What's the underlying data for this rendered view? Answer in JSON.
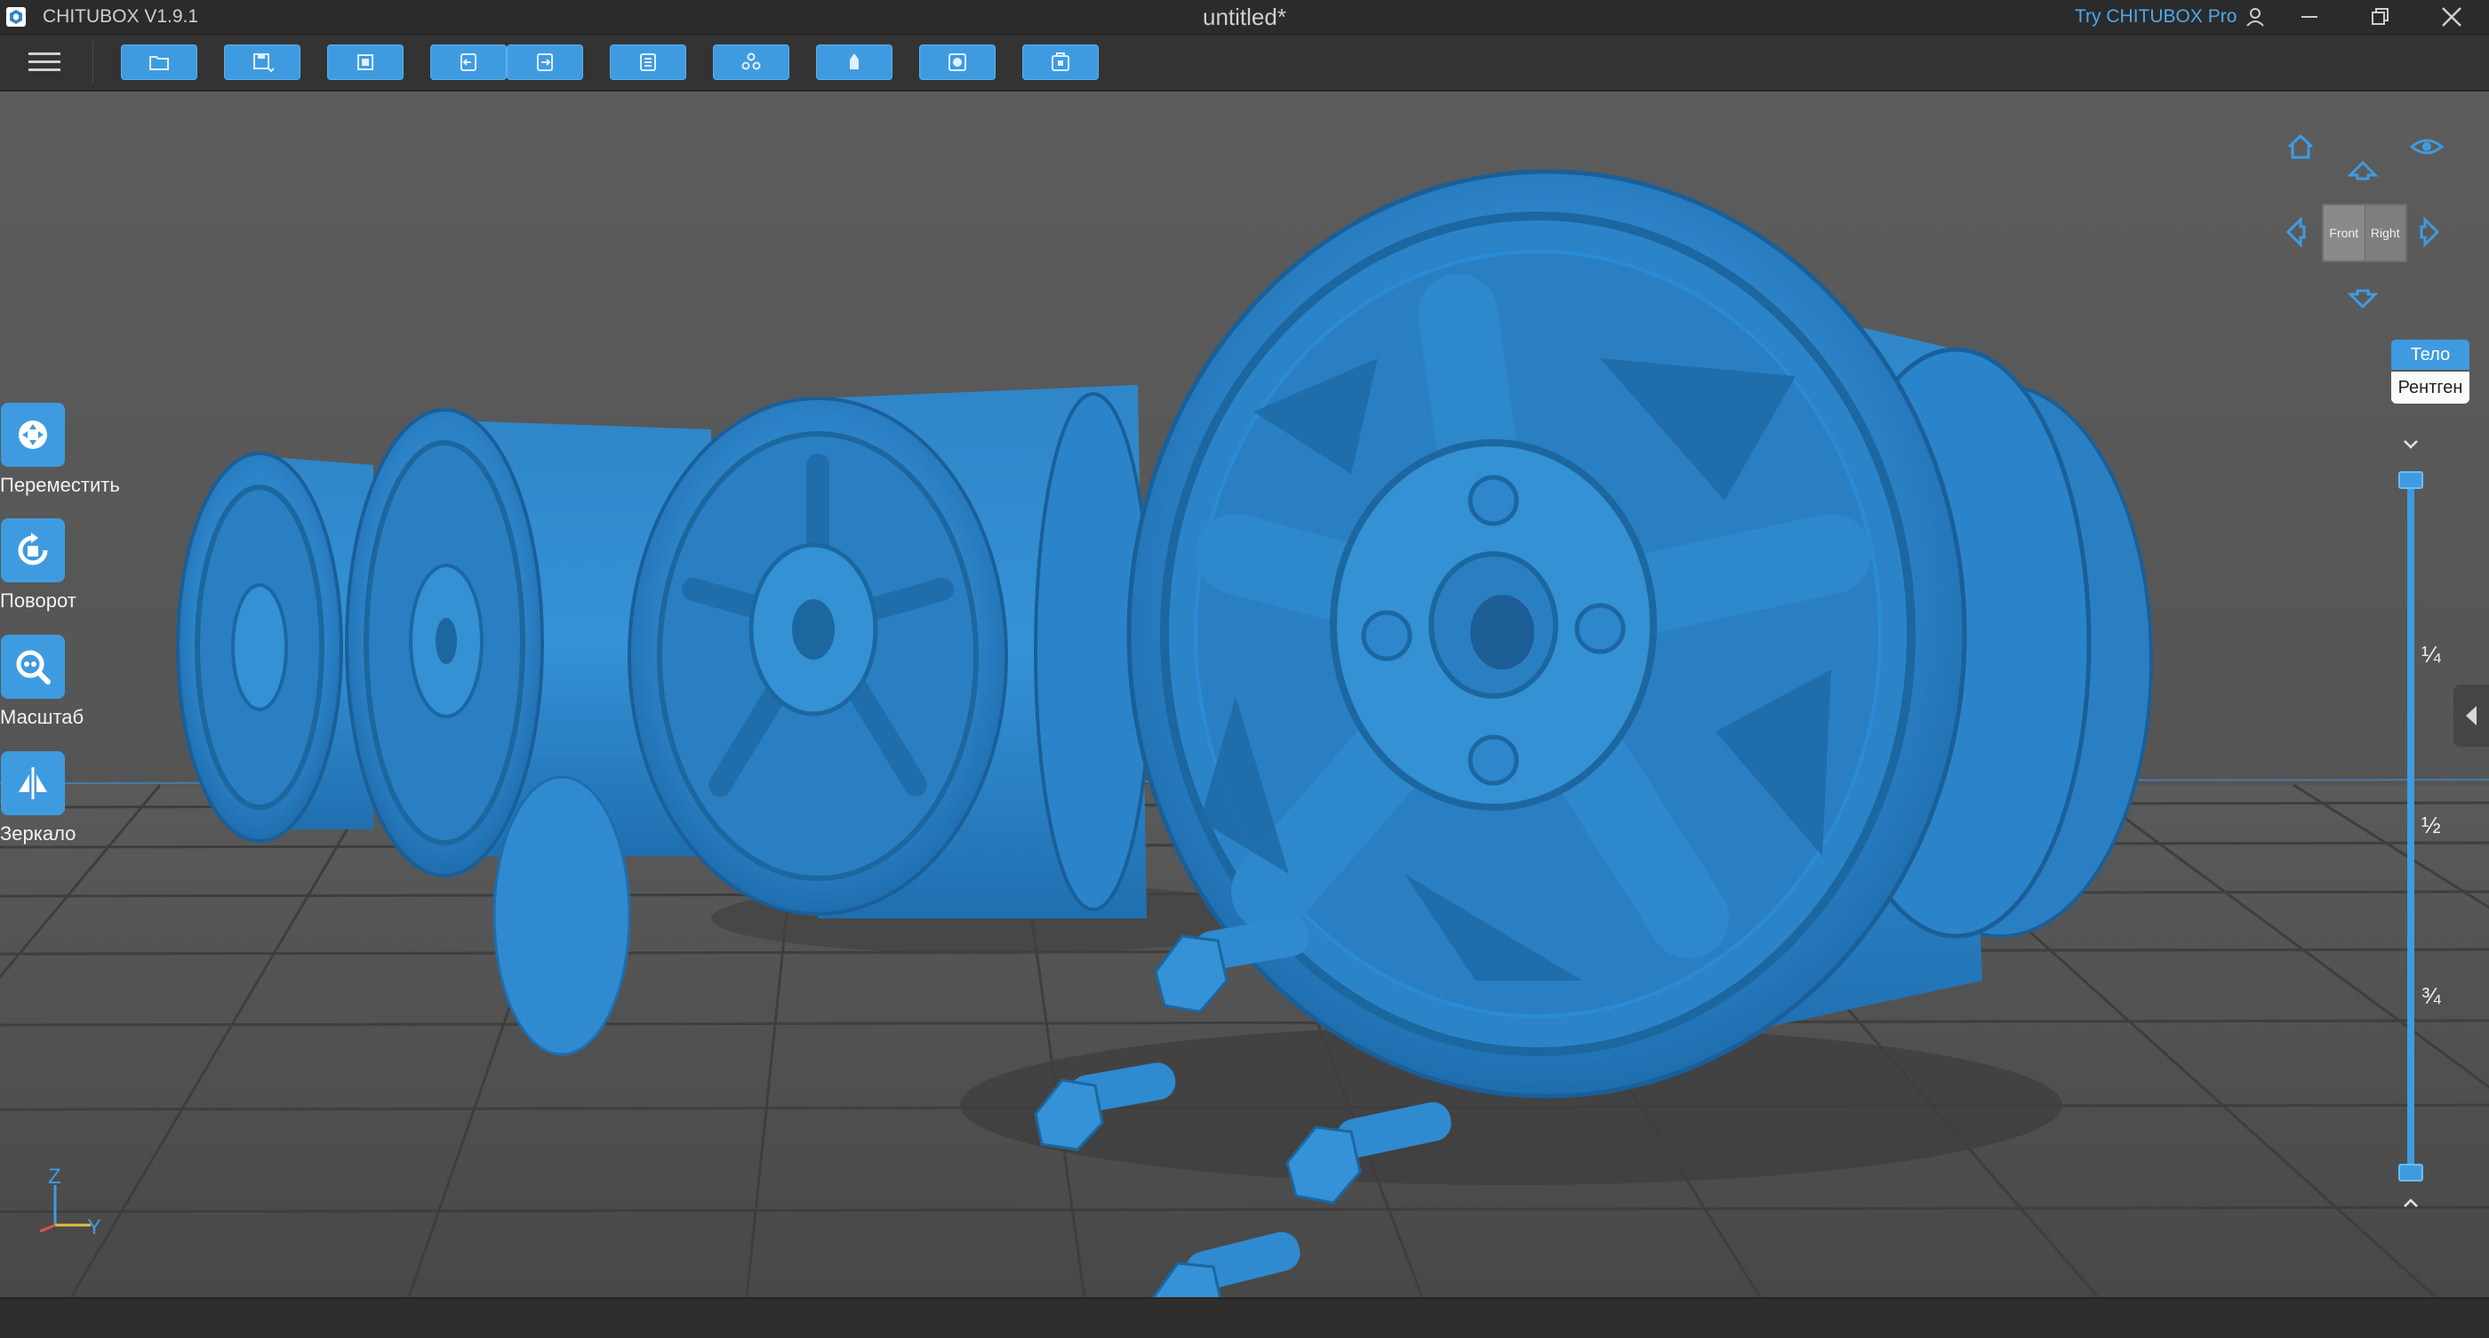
{
  "titlebar": {
    "app_name": "CHITUBOX V1.9.1",
    "document_title": "untitled*",
    "try_pro": "Try CHITUBOX Pro"
  },
  "toolbar": {
    "buttons": [
      {
        "name": "open-file",
        "icon": "folder-icon"
      },
      {
        "name": "save",
        "icon": "save-icon",
        "has_dropdown": true
      },
      {
        "name": "import-model",
        "icon": "import-icon"
      },
      {
        "name": "undo",
        "icon": "undo-icon"
      },
      {
        "name": "redo",
        "icon": "redo-icon"
      },
      {
        "name": "model-list",
        "icon": "list-icon"
      },
      {
        "name": "auto-layout",
        "icon": "layout-icon"
      },
      {
        "name": "supports",
        "icon": "support-icon"
      },
      {
        "name": "hollow",
        "icon": "hollow-icon"
      },
      {
        "name": "dig-hole",
        "icon": "hole-icon"
      }
    ]
  },
  "tools": [
    {
      "label": "Переместить",
      "icon": "move-icon"
    },
    {
      "label": "Поворот",
      "icon": "rotate-icon"
    },
    {
      "label": "Масштаб",
      "icon": "scale-icon"
    },
    {
      "label": "Зеркало",
      "icon": "mirror-icon"
    }
  ],
  "viewcube": {
    "front": "Front",
    "right": "Right"
  },
  "render_mode": {
    "body": "Тело",
    "xray": "Рентген"
  },
  "clip_slider": {
    "ticks": [
      "¼",
      "½",
      "¾"
    ],
    "lower": 0.0,
    "upper": 1.0
  },
  "axes": {
    "z": "Z",
    "y": "Y"
  },
  "colors": {
    "accent": "#3f9be0",
    "model": "#2f86c8",
    "background": "#2d2d2d"
  }
}
